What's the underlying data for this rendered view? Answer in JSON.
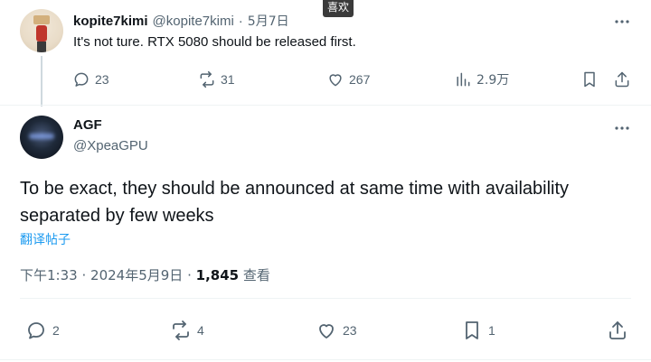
{
  "tooltip": {
    "text": "喜欢"
  },
  "reply_tweet": {
    "display_name": "kopite7kimi",
    "handle": "@kopite7kimi",
    "separator": "·",
    "date": "5月7日",
    "text": "It's not ture. RTX 5080 should be released first.",
    "more_icon": "more-horizontal-icon",
    "actions": {
      "replies": "23",
      "reposts": "31",
      "likes": "267",
      "views": "2.9万"
    }
  },
  "main_tweet": {
    "display_name": "AGF",
    "handle": "@XpeaGPU",
    "more_icon": "more-horizontal-icon",
    "text": "To be exact, they should be announced at same time with availability separated by few weeks",
    "translate_label": "翻译帖子",
    "time": "下午1:33",
    "meta_separator": "·",
    "date": "2024年5月9日",
    "meta_separator2": "·",
    "views_count": "1,845",
    "views_label": "查看",
    "actions": {
      "replies": "2",
      "reposts": "4",
      "likes": "23",
      "bookmarks": "1"
    }
  }
}
